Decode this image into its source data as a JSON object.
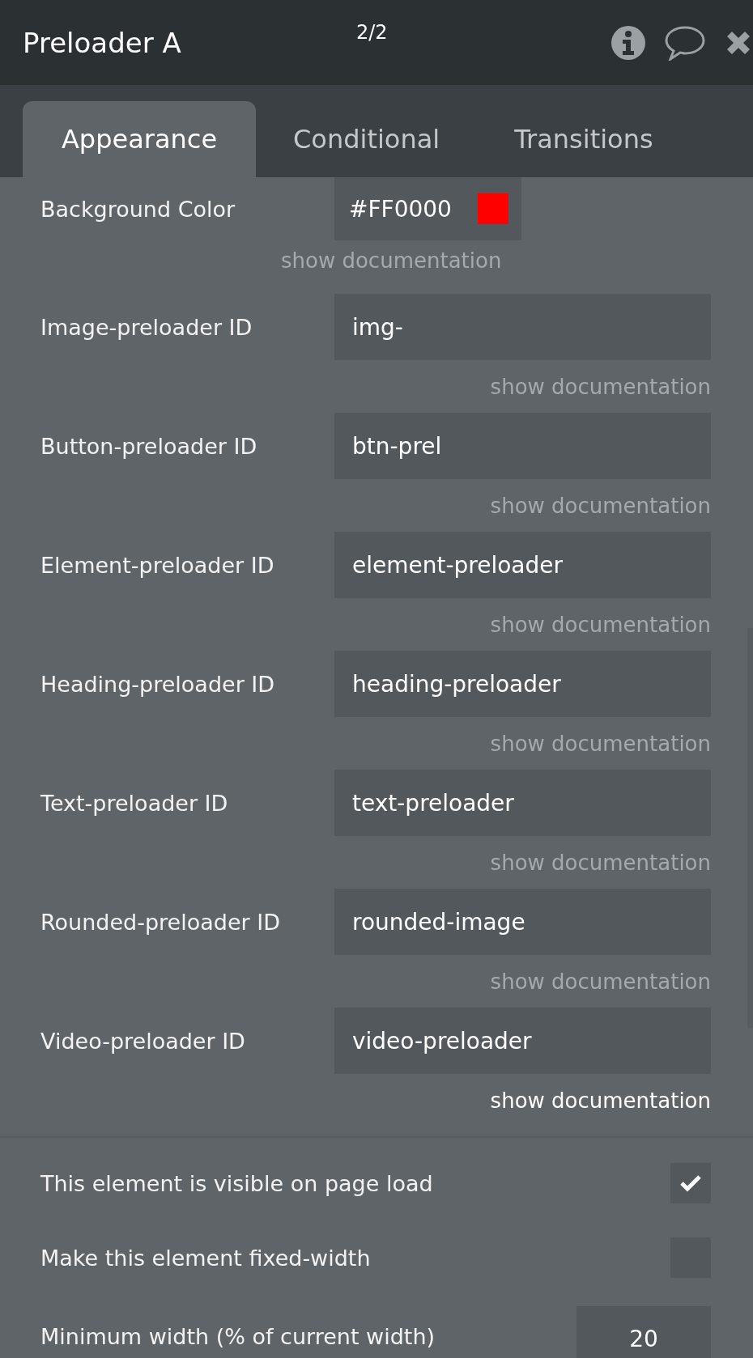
{
  "header": {
    "title": "Preloader A",
    "page_indicator": "2/2"
  },
  "tabs": [
    {
      "label": "Appearance",
      "selected": true
    },
    {
      "label": "Conditional",
      "selected": false
    },
    {
      "label": "Transitions",
      "selected": false
    }
  ],
  "background_color": {
    "label": "Background Color",
    "value": "#FF0000",
    "color": "#ff0000",
    "doc_link": "show documentation"
  },
  "fields": [
    {
      "label": "Image-preloader ID",
      "value": "img-",
      "doc_link": "show documentation",
      "highlighted": false
    },
    {
      "label": "Button-preloader ID",
      "value": "btn-prel",
      "doc_link": "show documentation",
      "highlighted": false
    },
    {
      "label": "Element-preloader ID",
      "value": "element-preloader",
      "doc_link": "show documentation",
      "highlighted": false
    },
    {
      "label": "Heading-preloader ID",
      "value": "heading-preloader",
      "doc_link": "show documentation",
      "highlighted": false
    },
    {
      "label": "Text-preloader ID",
      "value": "text-preloader",
      "doc_link": "show documentation",
      "highlighted": false
    },
    {
      "label": "Rounded-preloader ID",
      "value": "rounded-image",
      "doc_link": "show documentation",
      "highlighted": false
    },
    {
      "label": "Video-preloader ID",
      "value": "video-preloader",
      "doc_link": "show documentation",
      "highlighted": true
    }
  ],
  "options": [
    {
      "label": "This element is visible on page load",
      "checked": true
    },
    {
      "label": "Make this element fixed-width",
      "checked": false
    }
  ],
  "min_width": {
    "label": "Minimum width (% of current width)",
    "value": "20"
  }
}
